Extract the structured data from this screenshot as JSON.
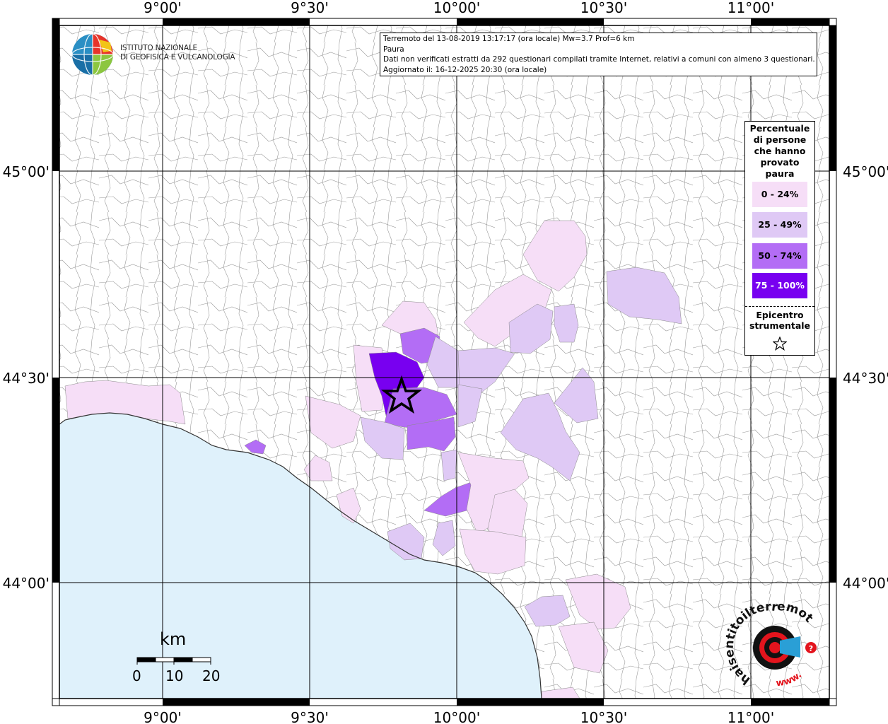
{
  "map": {
    "x_ticks": [
      "9°00'",
      "9°30'",
      "10°00'",
      "10°30'",
      "11°00'"
    ],
    "y_ticks": [
      "45°00'",
      "44°30'",
      "44°00'"
    ],
    "sea_color": "#dff1fb",
    "land_color": "#ffffff",
    "grid_color": "#000000"
  },
  "info": {
    "line1": "Terremoto del 13-08-2019 13:17:17 (ora locale) Mw=3.7 Prof=6 km",
    "line2": "Paura",
    "line3": "Dati non verificati estratti da 292 questionari compilati tramite Internet, relativi a comuni con almeno 3 questionari.",
    "line4": "Aggiornato il: 16-12-2025 20:30 (ora locale)"
  },
  "logo": {
    "line1": "ISTITUTO NAZIONALE",
    "line2": "DI GEOFISICA E VULCANOLOGIA"
  },
  "legend": {
    "title": [
      "Percentuale",
      "di persone",
      "che hanno",
      "provato",
      "paura"
    ],
    "items": [
      {
        "label": "0 - 24%",
        "color": "#f6def7"
      },
      {
        "label": "25 - 49%",
        "color": "#dfc9f5"
      },
      {
        "label": "50 - 74%",
        "color": "#b36df5"
      },
      {
        "label": "75 - 100%",
        "color": "#7800f0"
      }
    ],
    "epicenter": [
      "Epicentro",
      "strumentale"
    ]
  },
  "scale_bar": {
    "unit": "km",
    "labels": [
      "0",
      "10",
      "20"
    ]
  },
  "watermark": {
    "text": "haisentitoilterremoto.it",
    "www": "www."
  }
}
